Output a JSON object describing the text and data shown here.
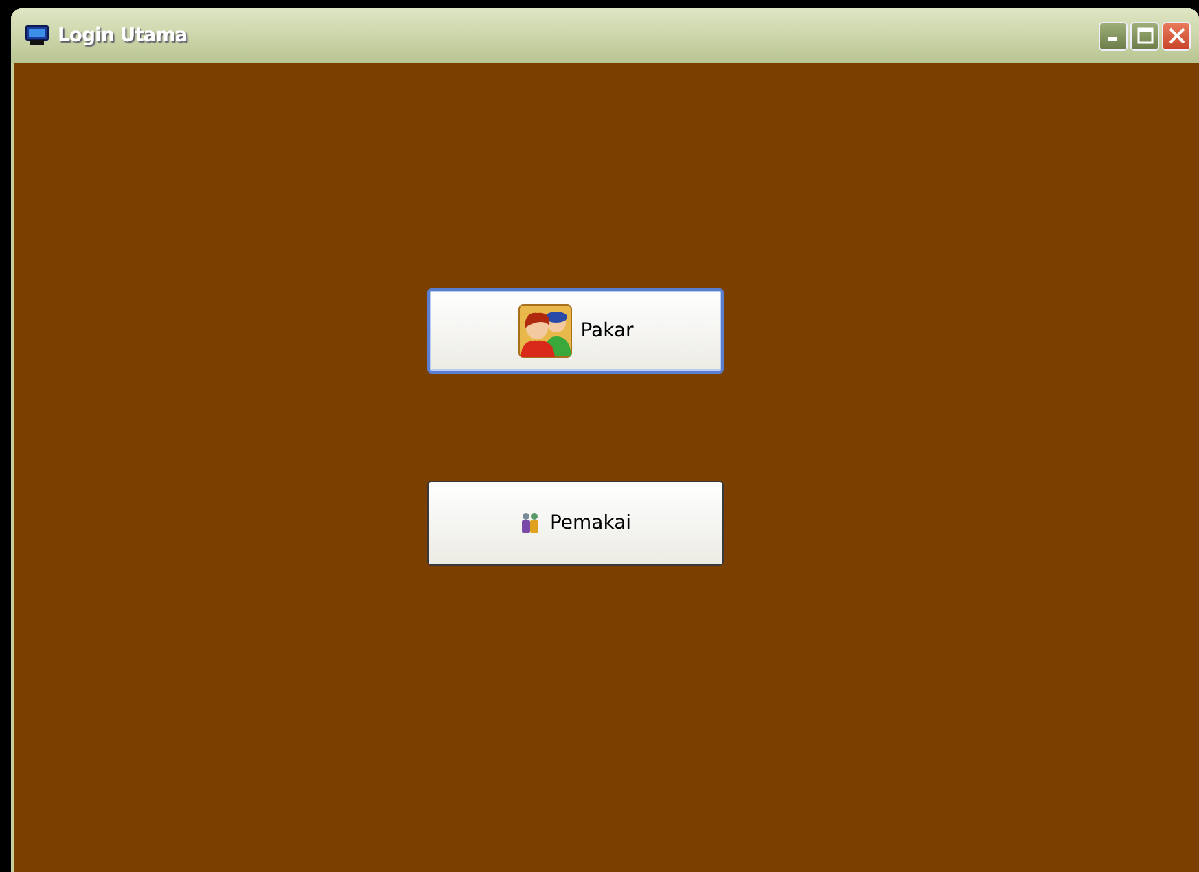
{
  "window": {
    "title": "Login Utama"
  },
  "buttons": [
    {
      "label": "Pakar",
      "kind": "large-icon",
      "focused": true
    },
    {
      "label": "Pemakai",
      "kind": "small-icon",
      "focused": false
    }
  ]
}
